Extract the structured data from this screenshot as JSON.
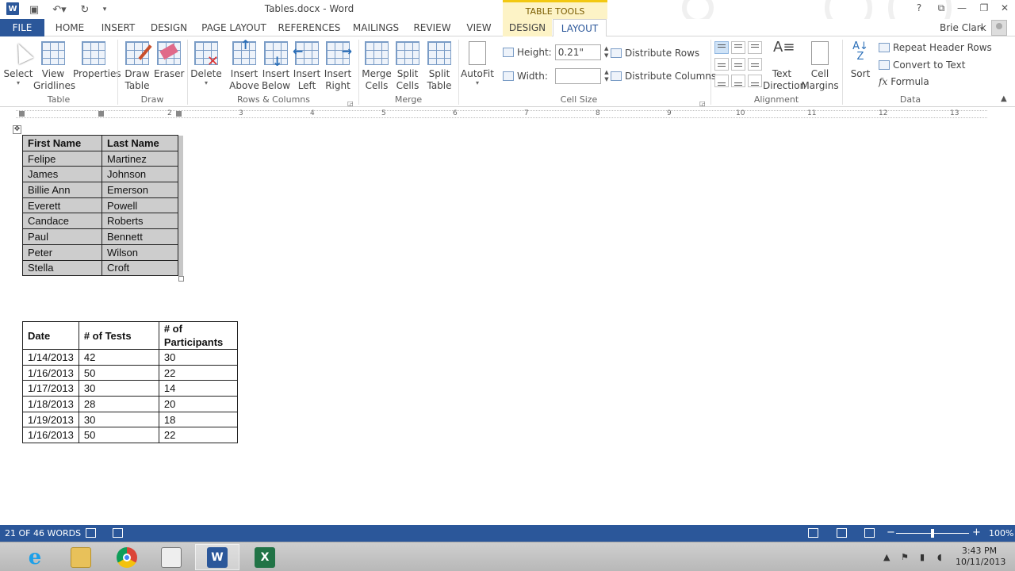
{
  "window": {
    "title": "Tables.docx - Word",
    "context_tab_group": "TABLE TOOLS",
    "user_name": "Brie Clark",
    "help_glyph": "?",
    "controls": {
      "ribbon_options": "⧉",
      "minimize": "—",
      "maximize": "❐",
      "close": "✕"
    }
  },
  "tabs": [
    "FILE",
    "HOME",
    "INSERT",
    "DESIGN",
    "PAGE LAYOUT",
    "REFERENCES",
    "MAILINGS",
    "REVIEW",
    "VIEW",
    "DESIGN",
    "LAYOUT"
  ],
  "ribbon": {
    "table_group": {
      "label": "Table",
      "select": "Select",
      "view_gridlines_1": "View",
      "view_gridlines_2": "Gridlines",
      "properties": "Properties"
    },
    "draw_group": {
      "label": "Draw",
      "draw_table_1": "Draw",
      "draw_table_2": "Table",
      "eraser": "Eraser"
    },
    "rows_columns_group": {
      "label": "Rows & Columns",
      "delete": "Delete",
      "insert_above_1": "Insert",
      "insert_above_2": "Above",
      "insert_below_1": "Insert",
      "insert_below_2": "Below",
      "insert_left_1": "Insert",
      "insert_left_2": "Left",
      "insert_right_1": "Insert",
      "insert_right_2": "Right"
    },
    "merge_group": {
      "label": "Merge",
      "merge_cells_1": "Merge",
      "merge_cells_2": "Cells",
      "split_cells_1": "Split",
      "split_cells_2": "Cells",
      "split_table_1": "Split",
      "split_table_2": "Table"
    },
    "cell_size_group": {
      "label": "Cell Size",
      "autofit": "AutoFit",
      "height_label": "Height:",
      "height_value": "0.21\"",
      "width_label": "Width:",
      "width_value": "",
      "distribute_rows": "Distribute Rows",
      "distribute_columns": "Distribute Columns"
    },
    "alignment_group": {
      "label": "Alignment",
      "text_direction_1": "Text",
      "text_direction_2": "Direction",
      "cell_margins_1": "Cell",
      "cell_margins_2": "Margins"
    },
    "data_group": {
      "label": "Data",
      "sort": "Sort",
      "repeat_header_rows": "Repeat Header Rows",
      "convert_to_text": "Convert to Text",
      "formula": "Formula",
      "formula_glyph": "fx"
    }
  },
  "ruler": {
    "ticks": [
      "2",
      "3",
      "4",
      "5",
      "6",
      "7",
      "8",
      "9",
      "10",
      "11",
      "12",
      "13"
    ]
  },
  "table_names": {
    "headers": [
      "First Name",
      "Last Name"
    ],
    "rows": [
      [
        "Felipe",
        "Martinez"
      ],
      [
        "James",
        "Johnson"
      ],
      [
        "Billie Ann",
        "Emerson"
      ],
      [
        "Everett",
        "Powell"
      ],
      [
        "Candace",
        "Roberts"
      ],
      [
        "Paul",
        "Bennett"
      ],
      [
        "Peter",
        "Wilson"
      ],
      [
        "Stella",
        "Croft"
      ]
    ]
  },
  "table_tests": {
    "headers": [
      "Date",
      "# of Tests",
      "# of",
      "Participants"
    ],
    "rows": [
      [
        "1/14/2013",
        "42",
        "30"
      ],
      [
        "1/16/2013",
        "50",
        "22"
      ],
      [
        "1/17/2013",
        "30",
        "14"
      ],
      [
        "1/18/2013",
        "28",
        "20"
      ],
      [
        "1/19/2013",
        "30",
        "18"
      ],
      [
        "1/16/2013",
        "50",
        "22"
      ]
    ]
  },
  "statusbar": {
    "word_count": "21 OF 46 WORDS",
    "zoom": "100%",
    "zoom_minus": "−",
    "zoom_plus": "+"
  },
  "taskbar": {
    "time": "3:43 PM",
    "date": "10/11/2013"
  },
  "colors": {
    "accent": "#2b579a",
    "context_tab": "#fdf3c6",
    "selection": "#cdcdcd"
  }
}
